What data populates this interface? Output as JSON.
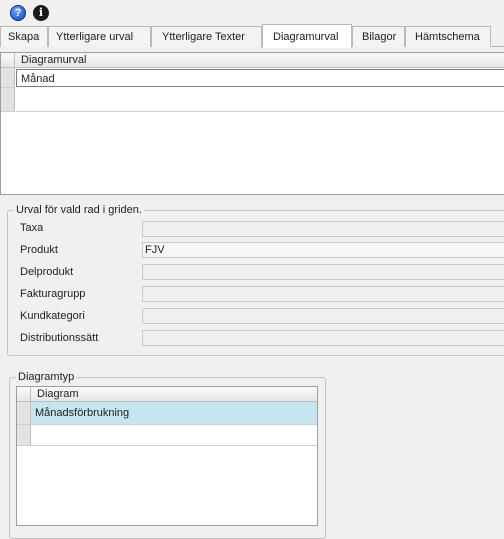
{
  "toolbar": {
    "help_icon": "?",
    "info_icon": "i"
  },
  "tabs": [
    {
      "label": "Skapa",
      "active": false
    },
    {
      "label": "Ytterligare urval",
      "active": false
    },
    {
      "label": "Ytterligare Texter",
      "active": false
    },
    {
      "label": "Diagramurval",
      "active": true
    },
    {
      "label": "Bilagor",
      "active": false
    },
    {
      "label": "Hämtschema",
      "active": false
    }
  ],
  "diagramurval_grid": {
    "header": "Diagramurval",
    "rows": [
      "Månad"
    ]
  },
  "selection": {
    "title": "Urval för vald rad  i griden.",
    "fields": [
      {
        "label": "Taxa",
        "value": ""
      },
      {
        "label": "Produkt",
        "value": "FJV"
      },
      {
        "label": "Delprodukt",
        "value": ""
      },
      {
        "label": "Fakturagrupp",
        "value": ""
      },
      {
        "label": "Kundkategori",
        "value": ""
      },
      {
        "label": "Distributionssätt",
        "value": ""
      }
    ]
  },
  "diagramtyp": {
    "title": "Diagramtyp",
    "header": "Diagram",
    "rows": [
      "Månadsförbrukning"
    ]
  },
  "colors": {
    "selected_row": "#c6e6ef",
    "background": "#f0f0f0"
  }
}
